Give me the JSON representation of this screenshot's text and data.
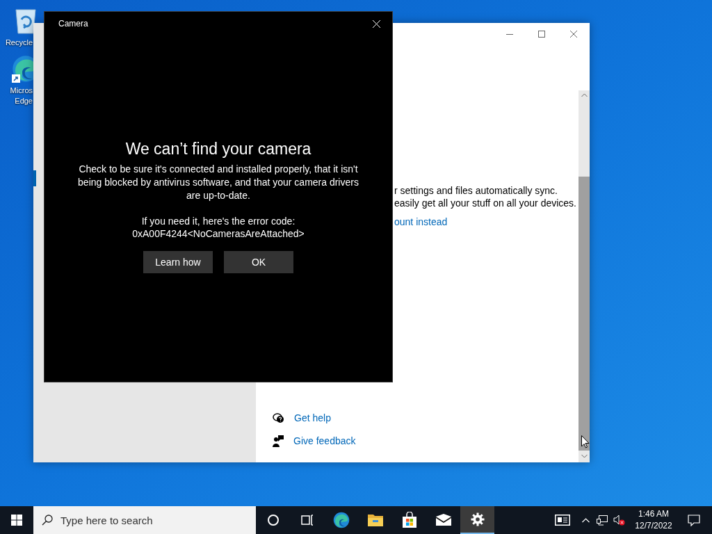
{
  "desktop_icons": [
    {
      "kind": "recycle-bin",
      "label": "Recycle"
    },
    {
      "kind": "edge",
      "label": "Micros\nEdge"
    }
  ],
  "settings_window": {
    "lines": [
      "r settings and files automatically sync.",
      "easily get all your stuff on all your devices."
    ],
    "link": "ount instead",
    "help_links": [
      {
        "kind": "help",
        "label": "Get help"
      },
      {
        "kind": "feedback",
        "label": "Give feedback"
      }
    ]
  },
  "camera_window": {
    "title": "Camera",
    "heading": "We can’t find your camera",
    "message": "Check to be sure it's connected and installed properly, that it isn't being blocked by antivirus software, and that your camera drivers are up-to-date.",
    "error_intro": "If you need it, here's the error code:",
    "error_code": "0xA00F4244<NoCamerasAreAttached>",
    "buttons": [
      "Learn how",
      "OK"
    ]
  },
  "taskbar": {
    "search": {
      "placeholder": "Type here to search"
    },
    "apps": [
      {
        "kind": "cortana",
        "selected": false
      },
      {
        "kind": "task-view",
        "selected": false
      },
      {
        "kind": "edge",
        "selected": false
      },
      {
        "kind": "explorer",
        "selected": false
      },
      {
        "kind": "store",
        "selected": false
      },
      {
        "kind": "mail",
        "selected": false
      },
      {
        "kind": "settings",
        "selected": true
      }
    ],
    "time": "1:46 AM",
    "date": "12/7/2022"
  }
}
